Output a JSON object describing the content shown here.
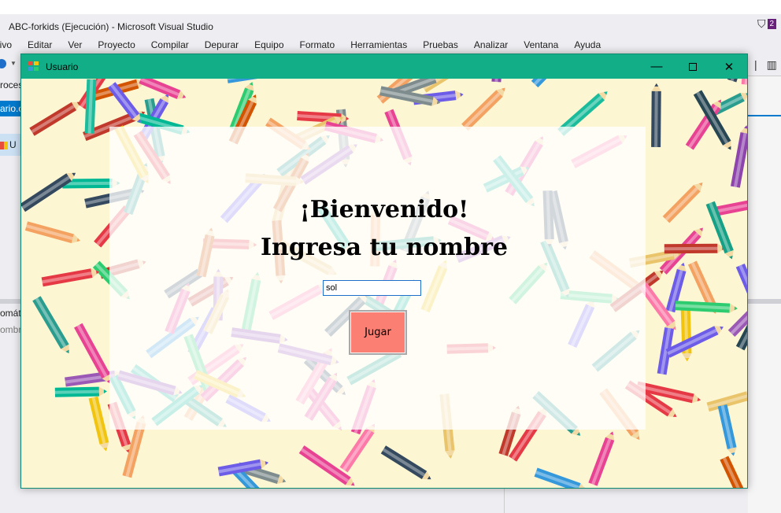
{
  "vs": {
    "title": "ABC-forkids (Ejecución) - Microsoft Visual Studio",
    "notification_count": "2",
    "menu": [
      "aivo",
      "Editar",
      "Ver",
      "Proyecto",
      "Compilar",
      "Depurar",
      "Equipo",
      "Formato",
      "Herramientas",
      "Pruebas",
      "Analizar",
      "Ventana",
      "Ayuda"
    ],
    "left_panel": {
      "item1": "roces",
      "item2": "ario.c",
      "item3": "U"
    },
    "bottom_panel": {
      "line1": "omát",
      "line2": "ombr"
    },
    "accent": "#007acc"
  },
  "form": {
    "title": "Usuario",
    "titlebar_color": "#11ae88",
    "heading": "¡Bienvenido!",
    "subheading": "Ingresa tu nombre",
    "name_value": "sol",
    "play_label": "Jugar",
    "play_color": "#fb7f73"
  }
}
